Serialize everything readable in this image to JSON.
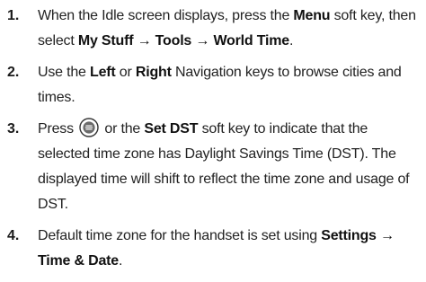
{
  "steps": [
    {
      "number": "1.",
      "t1": "When the Idle screen displays, press the ",
      "b1": "Menu",
      "t2": " soft key, then select ",
      "b2": "My Stuff",
      "arrow1": " → ",
      "b3": "Tools",
      "arrow2": " → ",
      "b4": "World Time",
      "t3": "."
    },
    {
      "number": "2.",
      "t1": "Use the ",
      "b1": "Left",
      "t2": " or ",
      "b2": "Right",
      "t3": " Navigation keys to browse cities and times."
    },
    {
      "number": "3.",
      "t1": "Press ",
      "icon": "navigation-key-icon",
      "t2": " or the ",
      "b1": "Set DST",
      "t3": " soft key to indicate that the selected time zone has Daylight Savings Time (DST). The displayed time will shift to reflect the time zone and usage of DST."
    },
    {
      "number": "4.",
      "t1": "Default time zone for the handset is set using ",
      "b1": "Settings",
      "arrow1": " → ",
      "b2": "Time & Date",
      "t2": "."
    }
  ]
}
